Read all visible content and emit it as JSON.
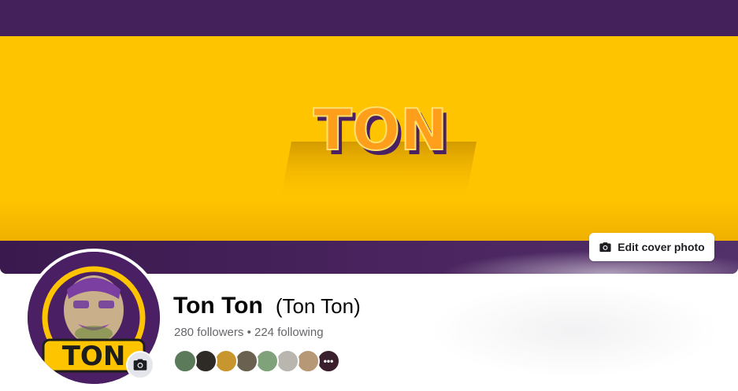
{
  "cover": {
    "logo_text": "TON",
    "edit_button_label": "Edit cover photo"
  },
  "profile": {
    "avatar_logo_text": "TON",
    "name": "Ton Ton",
    "alternate_name": "(Ton Ton)",
    "followers_text": "280 followers",
    "separator": "•",
    "following_text": "224 following"
  },
  "friends": {
    "avatars": [
      {
        "color": "#5a7a5a"
      },
      {
        "color": "#2e2a26"
      },
      {
        "color": "#c8962e"
      },
      {
        "color": "#6b6150"
      },
      {
        "color": "#7fa27a"
      },
      {
        "color": "#b9b6b0"
      },
      {
        "color": "#b79876"
      },
      {
        "color": "#3a1f2c"
      }
    ],
    "more_icon": "ellipsis-icon"
  },
  "colors": {
    "cover_yellow": "#ffc400",
    "cover_purple": "#44215a",
    "logo_orange": "#ff9e1a"
  }
}
